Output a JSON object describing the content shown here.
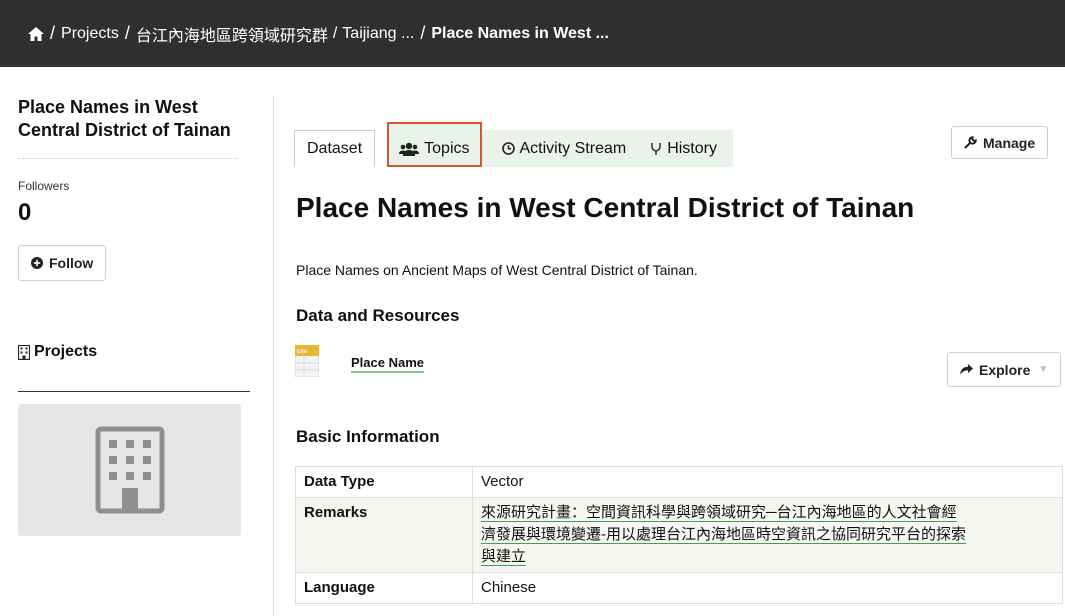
{
  "breadcrumb": {
    "items": [
      "Projects",
      "台江內海地區跨領域研究群",
      "Taijiang ..."
    ],
    "current": "Place Names in West ..."
  },
  "sidebar": {
    "dataset_title": "Place Names in West Central District of Tainan",
    "followers_label": "Followers",
    "followers_count": "0",
    "follow_label": "Follow",
    "projects_label": "Projects"
  },
  "tabs": [
    {
      "label": "Dataset",
      "icon": "none"
    },
    {
      "label": "Topics",
      "icon": "users-icon"
    },
    {
      "label": "Activity Stream",
      "icon": "clock-icon"
    },
    {
      "label": "History",
      "icon": "code-fork-icon"
    }
  ],
  "manage_label": "Manage",
  "main": {
    "title": "Place Names in West Central District of Tainan",
    "description": "Place Names on Ancient Maps of West Central District of Tainan.",
    "resources_heading": "Data and Resources",
    "resource": {
      "name": "Place Name",
      "format": "csv"
    },
    "explore_label": "Explore",
    "info_heading": "Basic Information",
    "info_rows": [
      {
        "key": "Data Type",
        "value": "Vector"
      },
      {
        "key": "Remarks",
        "value_lines": [
          "來源研究計畫：空間資訊科學與跨領域研究─台江內海地區的人文社會經",
          "濟發展與環境變遷-用以處理台江內海地區時空資訊之協同研究平台的探索",
          "與建立"
        ]
      },
      {
        "key": "Language",
        "value": "Chinese"
      }
    ]
  },
  "colors": {
    "topbar": "#2f2f2f",
    "tab_bg": "#eaf3ea",
    "highlight": "#d9532c",
    "link_underline": "#7cc98a"
  }
}
